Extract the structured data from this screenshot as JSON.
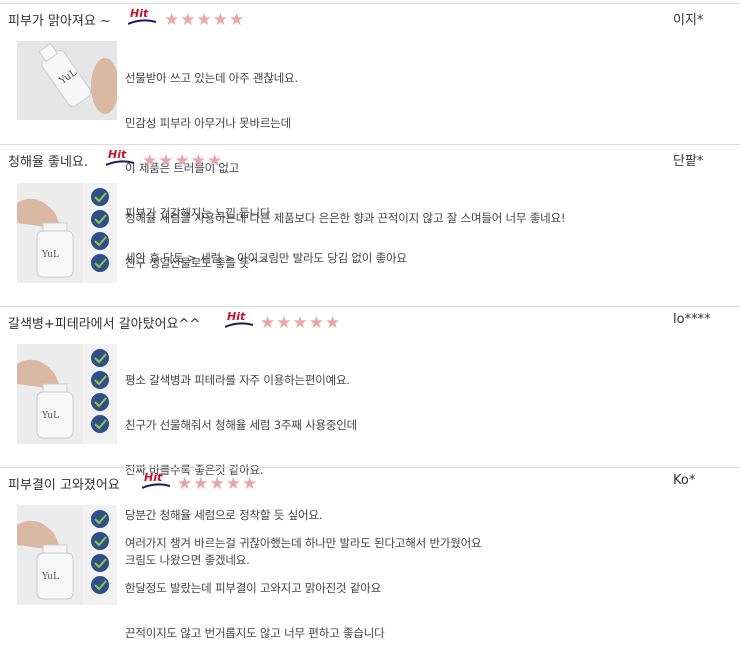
{
  "colors": {
    "star": "#e8a6a6",
    "hit": "#c8102e",
    "divider": "#dcdcdc"
  },
  "badge": {
    "label": "Hit"
  },
  "reviews": [
    {
      "title": "피부가 맑아져요 ~",
      "stars": "★★★★★",
      "rating": 5,
      "author": "이지*",
      "lines": [
        "선물받아 쓰고 있는데 아주 괜찮네요.",
        "민감성 피부라 아무거나 못바르는데",
        "이 제품은 트러블이 없고",
        "피부가 건강해지는 느낌 듭니다",
        "세안 후 닥토 > 세럼 > 아이크림만 발라도 당김 없이 좋아요"
      ]
    },
    {
      "title": "청해율 좋네요.",
      "stars": "★★★★★",
      "rating": 5,
      "author": "단팥*",
      "lines": [
        "청해율 세럼을 사용하는데 다른 제품보다 은은한 향과 끈적이지 않고 잘 스며들어 너무 좋네요!",
        "친구 생일선물로도 좋을 듯^^"
      ]
    },
    {
      "title": "갈색병+피테라에서 갈아탔어요^^",
      "stars": "★★★★★",
      "rating": 5,
      "author": "lo****",
      "lines": [
        "평소 갈색병과 피테라를 자주 이용하는편이예요.",
        "친구가 선물해줘서 청해율 세럼 3주째 사용중인데",
        "진짜 바를수록 좋은것 같아요.",
        "당분간 청해율 세럼으로 정착할 듯 싶어요.",
        "크림도 나왔으면 좋겠네요."
      ]
    },
    {
      "title": "피부결이 고와졌어요",
      "stars": "★★★★★",
      "rating": 5,
      "author": "Ko*",
      "lines": [
        "여러가지 챙겨 바르는걸 귀찮아했는데 하나만 발라도 된다고해서 반가웠어요",
        "한달정도 발랐는데 피부결이 고와지고 맑아진것 같아요",
        "끈적이지도 않고 번거롭지도 않고 너무 편하고 좋습니다"
      ]
    }
  ]
}
